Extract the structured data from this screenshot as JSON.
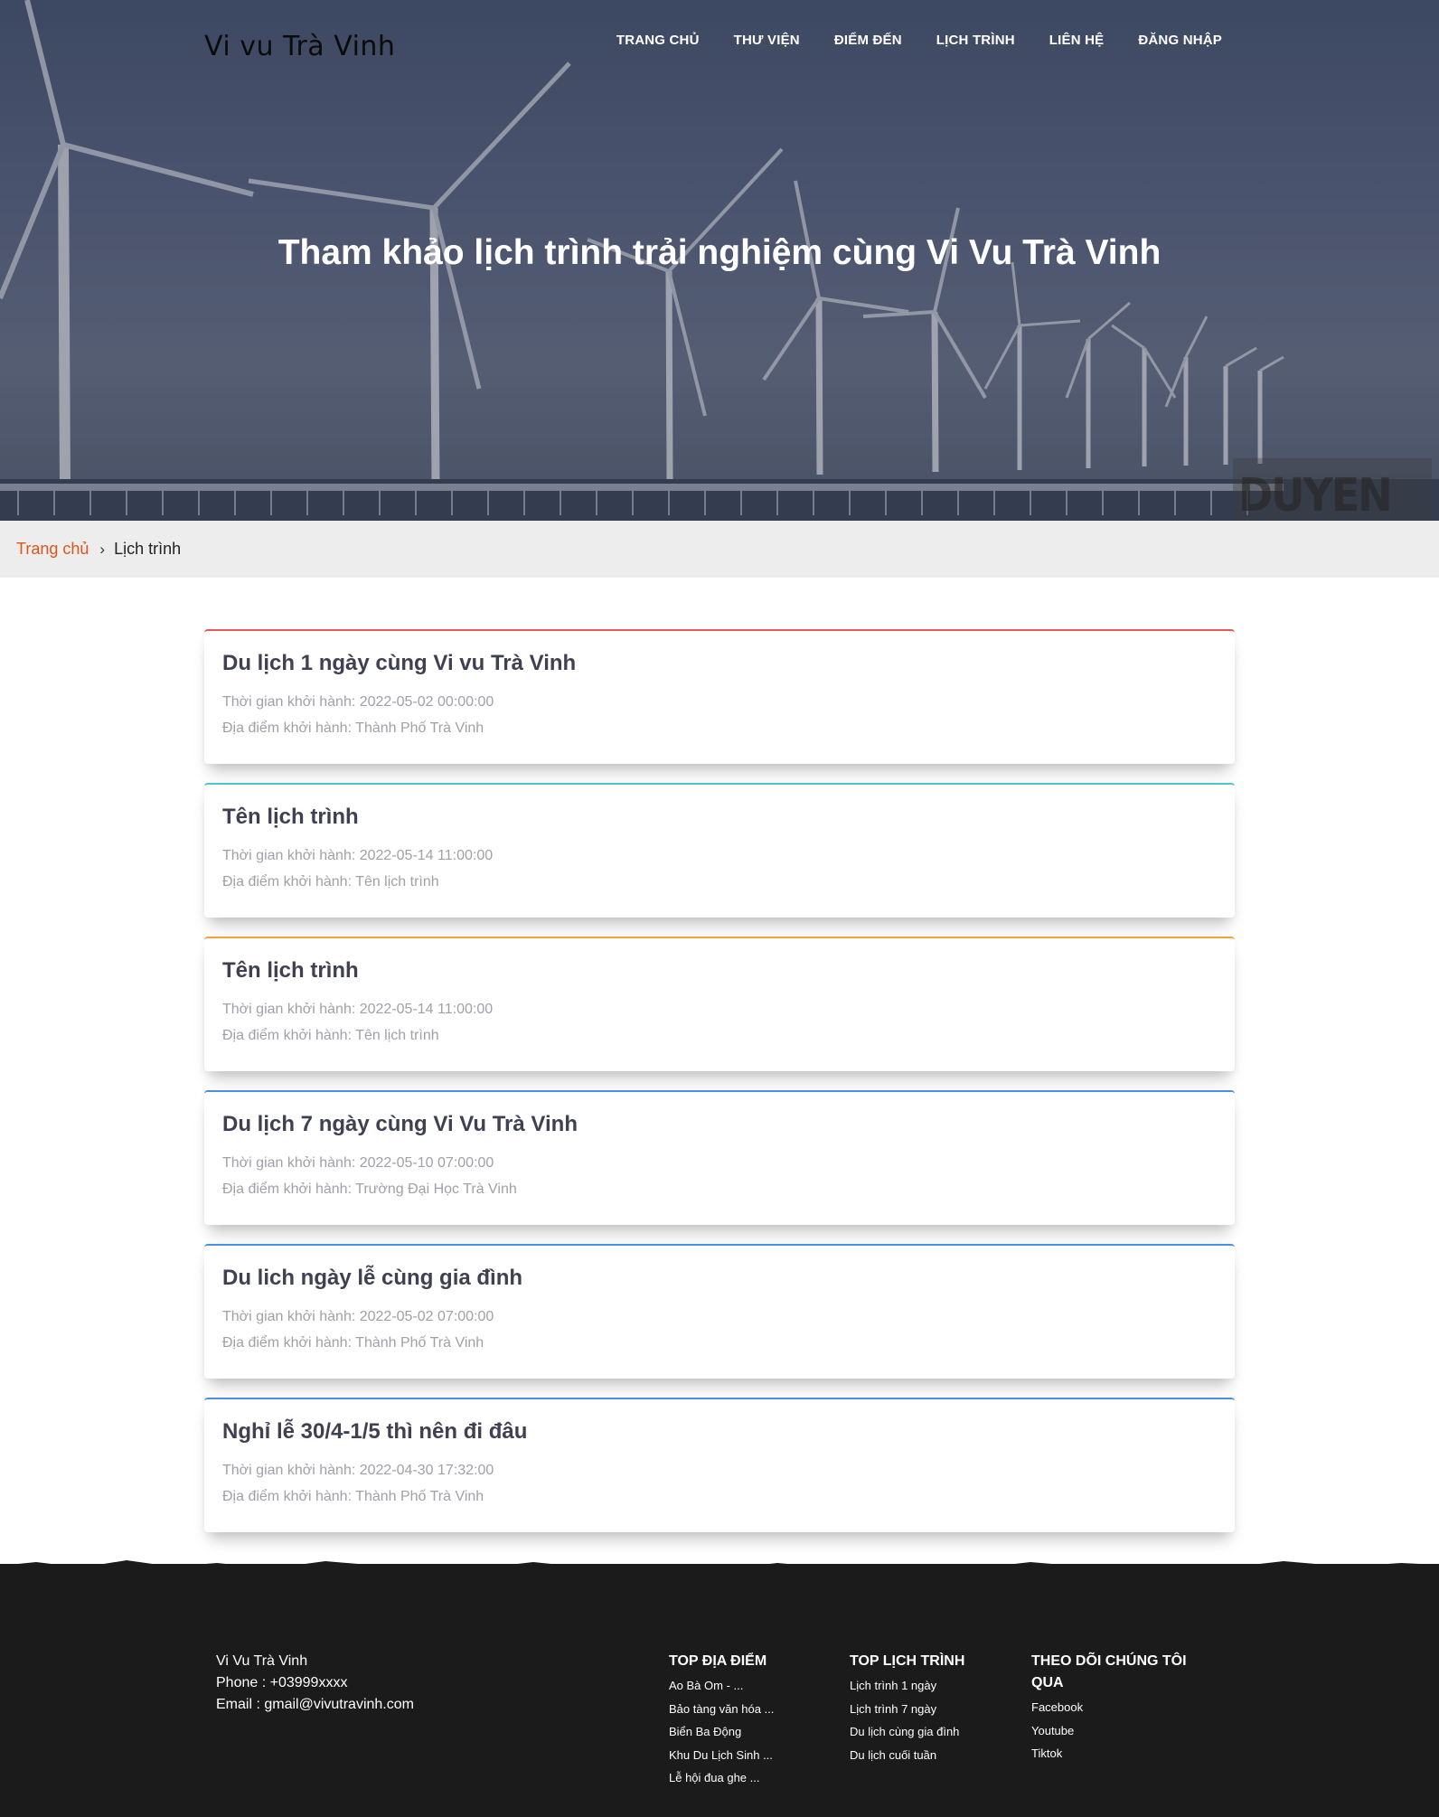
{
  "header": {
    "logo": "Vi vu Trà Vinh",
    "nav": [
      "TRANG CHỦ",
      "THƯ VIỆN",
      "ĐIỂM ĐẾN",
      "LỊCH TRÌNH",
      "LIÊN HỆ",
      "ĐĂNG NHẬP"
    ]
  },
  "hero": {
    "title": "Tham khảo lịch trình trải nghiệm cùng Vi Vu Trà Vinh",
    "watermark": "DUYEN HAI"
  },
  "breadcrumb": {
    "home": "Trang chủ",
    "separator": "›",
    "current": "Lịch trình"
  },
  "itineraries": [
    {
      "title": "Du lịch 1 ngày cùng Vi vu Trà Vinh",
      "departure_time": "Thời gian khởi hành: 2022-05-02 00:00:00",
      "departure_place": "Địa điểm khởi hành: Thành Phố Trà Vinh",
      "accent": "#e35a5a"
    },
    {
      "title": "Tên lịch trình",
      "departure_time": "Thời gian khởi hành: 2022-05-14 11:00:00",
      "departure_place": "Địa điểm khởi hành: Tên lịch trình",
      "accent": "#4cc6c9"
    },
    {
      "title": "Tên lịch trình",
      "departure_time": "Thời gian khởi hành: 2022-05-14 11:00:00",
      "departure_place": "Địa điểm khởi hành: Tên lịch trình",
      "accent": "#f0a13a"
    },
    {
      "title": "Du lịch 7 ngày cùng Vi Vu Trà Vinh",
      "departure_time": "Thời gian khởi hành: 2022-05-10 07:00:00",
      "departure_place": "Địa điểm khởi hành: Trường Đại Học Trà Vinh",
      "accent": "#4a90e2"
    },
    {
      "title": "Du lich ngày lễ cùng gia đình",
      "departure_time": "Thời gian khởi hành: 2022-05-02 07:00:00",
      "departure_place": "Địa điểm khởi hành: Thành Phố Trà Vinh",
      "accent": "#4a90e2"
    },
    {
      "title": "Nghỉ lễ 30/4-1/5 thì nên đi đâu",
      "departure_time": "Thời gian khởi hành: 2022-04-30 17:32:00",
      "departure_place": "Địa điểm khởi hành: Thành Phố Trà Vinh",
      "accent": "#4a90e2"
    }
  ],
  "footer": {
    "about": {
      "name": "Vi Vu Trà Vinh",
      "phone": "Phone : +03999xxxx",
      "email": "Email : gmail@vivutravinh.com"
    },
    "top_places": {
      "heading": "TOP ĐỊA ĐIỂM",
      "items": [
        "Ao Bà Om - ...",
        "Bảo tàng văn hóa ...",
        "Biển Ba Động",
        "Khu Du Lịch Sinh ...",
        "Lễ hội đua ghe ..."
      ]
    },
    "top_itineraries": {
      "heading": "TOP LỊCH TRÌNH",
      "items": [
        "Lịch trình 1 ngày",
        "Lịch trình 7 ngày",
        "Du lịch cùng gia đình",
        "Du lịch cuối tuần"
      ]
    },
    "follow": {
      "heading": "THEO DÕI CHÚNG TÔI QUA",
      "items": [
        "Facebook",
        "Youtube",
        "Tiktok"
      ]
    }
  }
}
